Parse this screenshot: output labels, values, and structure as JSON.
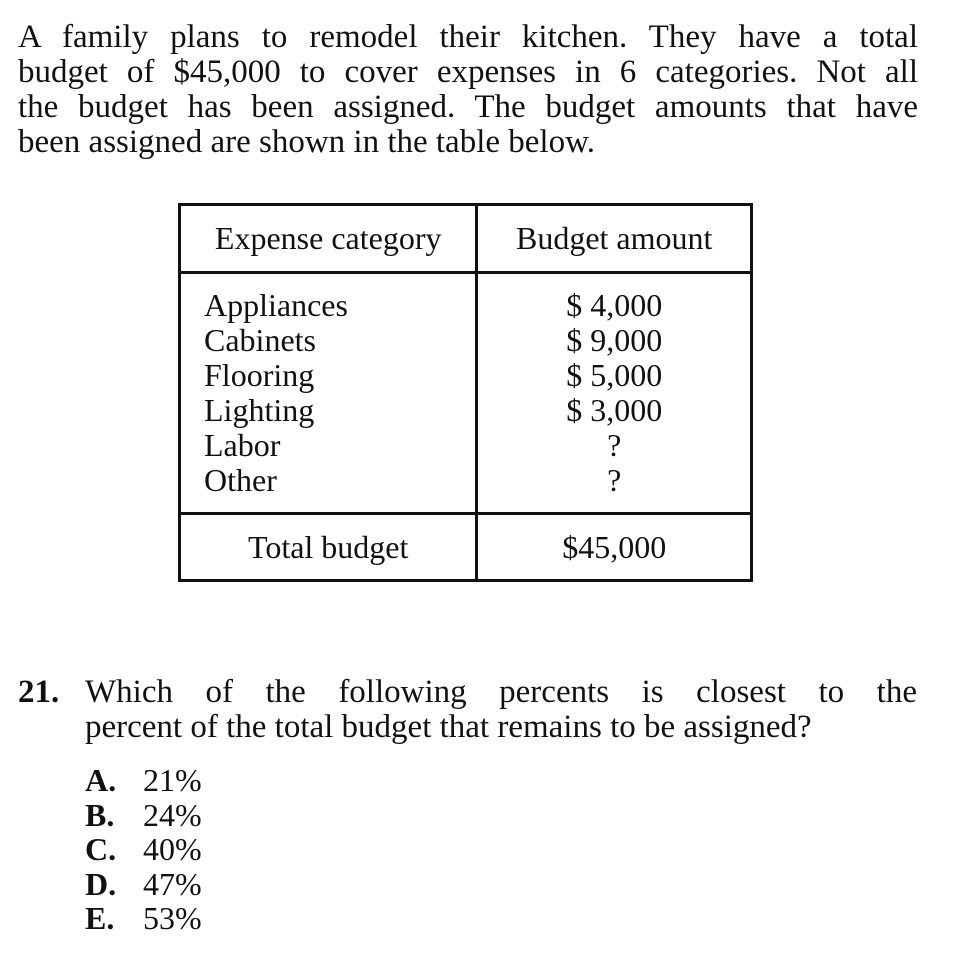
{
  "intro": {
    "lines": [
      "A family plans to remodel their kitchen. They have a total",
      "budget of $45,000 to cover expenses in 6 categories. Not all",
      "the budget has been assigned. The budget amounts that have",
      "been assigned are shown in the table below."
    ]
  },
  "table": {
    "headers": [
      "Expense category",
      "Budget amount"
    ],
    "rows": [
      {
        "category": "Appliances",
        "amount": "$ 4,000"
      },
      {
        "category": "Cabinets",
        "amount": "$ 9,000"
      },
      {
        "category": "Flooring",
        "amount": "$ 5,000"
      },
      {
        "category": "Lighting",
        "amount": "$ 3,000"
      },
      {
        "category": "Labor",
        "amount": "?"
      },
      {
        "category": "Other",
        "amount": "?"
      }
    ],
    "total_label": "Total budget",
    "total_amount": "$45,000"
  },
  "question": {
    "number": "21.",
    "lines": [
      "Which of the following percents is closest to the",
      "percent of the total budget that remains to be assigned?"
    ],
    "choices": [
      {
        "letter": "A.",
        "text": "21%"
      },
      {
        "letter": "B.",
        "text": "24%"
      },
      {
        "letter": "C.",
        "text": "40%"
      },
      {
        "letter": "D.",
        "text": "47%"
      },
      {
        "letter": "E.",
        "text": "53%"
      }
    ]
  }
}
